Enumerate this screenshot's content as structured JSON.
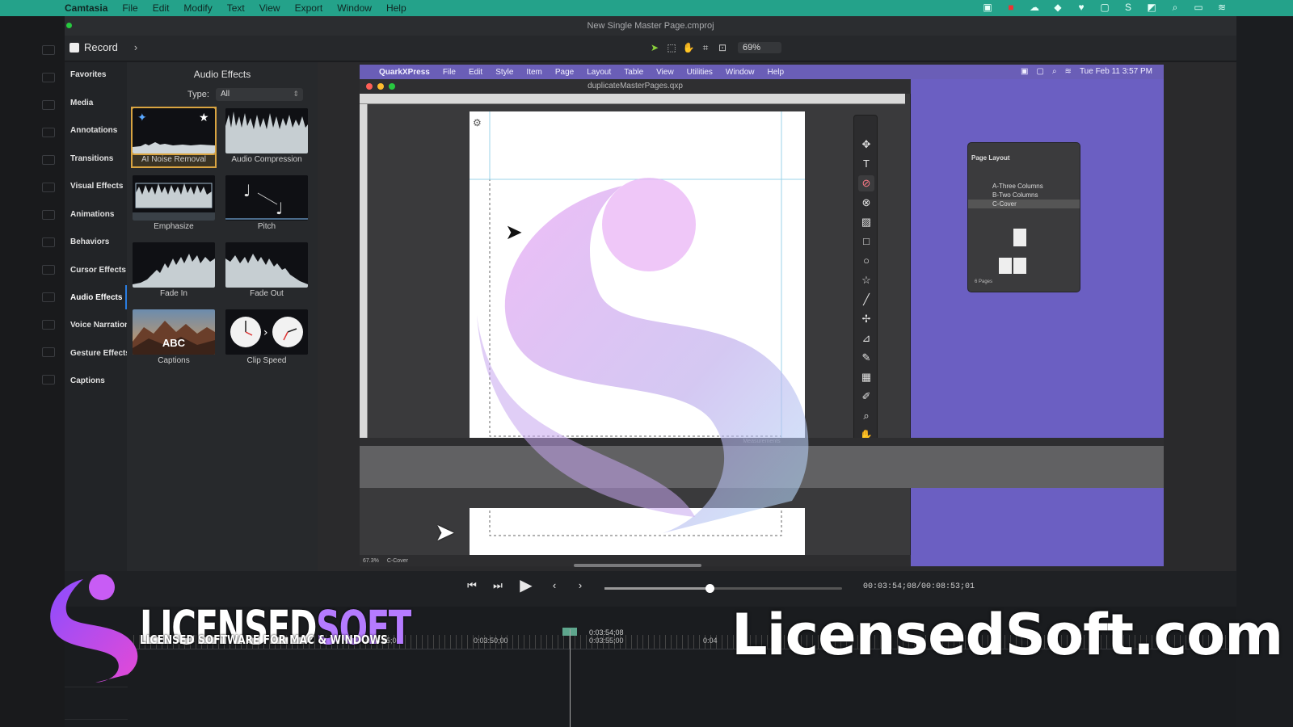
{
  "menubar": {
    "app": "Camtasia",
    "items": [
      "File",
      "Edit",
      "Modify",
      "Text",
      "View",
      "Export",
      "Window",
      "Help"
    ]
  },
  "titlebar": {
    "title": "New Single Master Page.cmproj"
  },
  "toolbar": {
    "record_label": "Record",
    "zoom": "69%"
  },
  "tabs": [
    "Favorites",
    "Media",
    "Annotations",
    "Transitions",
    "Visual Effects",
    "Animations",
    "Behaviors",
    "Cursor Effects",
    "Audio Effects",
    "Voice Narration",
    "Gesture Effects",
    "Captions"
  ],
  "library": {
    "title": "Audio Effects",
    "type_label": "Type:",
    "type_value": "All",
    "items": [
      {
        "label": "AI Noise Removal",
        "selected": true
      },
      {
        "label": "Audio Compression",
        "selected": false
      },
      {
        "label": "Emphasize",
        "selected": false
      },
      {
        "label": "Pitch",
        "selected": false
      },
      {
        "label": "Fade In",
        "selected": false
      },
      {
        "label": "Fade Out",
        "selected": false
      },
      {
        "label": "Captions",
        "selected": false,
        "thumb_text": "ABC"
      },
      {
        "label": "Clip Speed",
        "selected": false
      }
    ]
  },
  "quark": {
    "app": "QuarkXPress",
    "menus": [
      "File",
      "Edit",
      "Style",
      "Item",
      "Page",
      "Layout",
      "Table",
      "View",
      "Utilities",
      "Window",
      "Help"
    ],
    "clock": "Tue Feb 11  3:57 PM",
    "doc_title": "duplicateMasterPages.qxp",
    "measurements_label": "Measurements",
    "status_zoom": "67.3%",
    "status_page": "C-Cover",
    "page_layout": {
      "title": "Page Layout",
      "masters": [
        "A-Three Columns",
        "B-Two Columns",
        "C-Cover"
      ],
      "selected": "C-Cover",
      "pages_count": "6 Pages"
    }
  },
  "playback": {
    "timecode": "00:03:54;08/00:08:53;01"
  },
  "timeline": {
    "playhead_time": "0:03:54;08",
    "ticks": [
      "0:03:45;00",
      "0:03:50;00",
      "0:03:55;00",
      "0:04"
    ]
  },
  "watermark": {
    "logo_main": "LICENSED",
    "logo_accent": "SOFT",
    "logo_tagline": "LICENSED SOFTWARE FOR MAC & WINDOWS",
    "domain": "LicensedSoft.com"
  },
  "colors": {
    "menubar": "#24a28a",
    "selection": "#d9a441",
    "quark_bg": "#6b5fc2",
    "accent": "#b57bff"
  }
}
